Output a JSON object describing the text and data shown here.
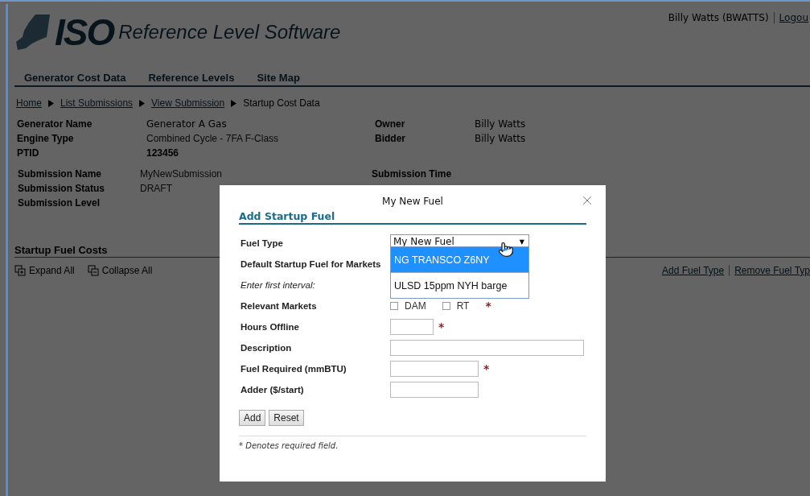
{
  "header": {
    "logo_text": "ISO",
    "app_title": "Reference Level Software",
    "user": "Billy Watts (BWATTS)",
    "logout": "Logou"
  },
  "nav": [
    {
      "label": "Generator Cost Data"
    },
    {
      "label": "Reference Levels"
    },
    {
      "label": "Site Map"
    }
  ],
  "breadcrumb": [
    {
      "label": "Home",
      "kind": "link"
    },
    {
      "label": "List Submissions",
      "kind": "link"
    },
    {
      "label": "View Submission",
      "kind": "link"
    },
    {
      "label": "Startup Cost Data",
      "kind": "current"
    }
  ],
  "generator": {
    "left": [
      {
        "label": "Generator Name",
        "value": "Generator A Gas",
        "kind": "strong"
      },
      {
        "label": "Engine Type",
        "value": "Combined Cycle - 7FA F-Class",
        "kind": "plain"
      },
      {
        "label": "PTID",
        "value": "123456",
        "kind": "bold"
      }
    ],
    "right": [
      {
        "label": "Owner",
        "value": "Billy Watts",
        "kind": "strong"
      },
      {
        "label": "Bidder",
        "value": "Billy Watts",
        "kind": "strong"
      }
    ]
  },
  "submission": {
    "left": [
      {
        "label": "Submission Name",
        "value": "MyNewSubmission"
      },
      {
        "label": "Submission Status",
        "value": "DRAFT"
      },
      {
        "label": "Submission Level"
      }
    ],
    "right": [
      {
        "label": "Submission Time"
      }
    ]
  },
  "section": {
    "title": "Startup Fuel Costs",
    "actions": [
      {
        "label": "Expand All",
        "kind": "expand"
      },
      {
        "label": "Collapse All",
        "kind": "collapse"
      }
    ],
    "links": [
      "Add Fuel Type",
      "Remove Fuel Typ"
    ]
  },
  "dialog": {
    "title": "My New Fuel",
    "heading": "Add Startup Fuel",
    "fields": [
      {
        "kind": "select",
        "label": "Fuel Type",
        "value": "My New Fuel",
        "caret": "▼",
        "expanded": true,
        "options": [
          {
            "label": "NG TRANSCO Z6NY",
            "selected": true
          },
          {
            "label": "ULSD 15ppm NYH barge",
            "selected": false
          }
        ]
      },
      {
        "kind": "blank",
        "label": "Default Startup Fuel for Markets"
      },
      {
        "kind": "note",
        "label": "Enter first interval:"
      },
      {
        "kind": "checkboxes",
        "label": "Relevant Markets",
        "required": true,
        "options": [
          {
            "label": "DAM",
            "checked": false
          },
          {
            "label": "RT",
            "checked": false
          }
        ]
      },
      {
        "kind": "short",
        "label": "Hours Offline",
        "required": true
      },
      {
        "kind": "long",
        "label": "Description",
        "required": false
      },
      {
        "kind": "input",
        "label": "Fuel Required (mmBTU)",
        "required": true
      },
      {
        "kind": "input",
        "label": "Adder ($/start)",
        "required": false
      }
    ],
    "required_mark": "*",
    "buttons": [
      "Add",
      "Reset"
    ],
    "footnote": "* Denotes required field."
  }
}
